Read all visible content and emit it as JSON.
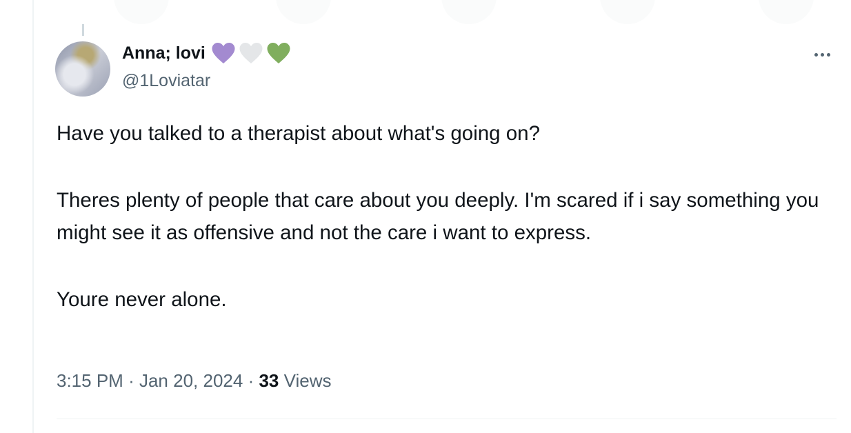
{
  "tweet": {
    "author_name": "Anna; lovi",
    "handle": "@1Loviatar",
    "emoji_hearts": [
      {
        "name": "purple-heart-icon",
        "color": "#a38ad0"
      },
      {
        "name": "white-heart-icon",
        "color": "#e4e6e8"
      },
      {
        "name": "green-heart-icon",
        "color": "#80ae5e"
      }
    ],
    "paragraphs": [
      "Have you talked to a therapist about what's going on?",
      "Theres plenty of people that care about you deeply. I'm scared if i say something you might see it as offensive and not the care i want to express.",
      "Youre never alone."
    ],
    "time": "3:15 PM",
    "date": "Jan 20, 2024",
    "separator": "·",
    "views_count": "33",
    "views_label": "Views"
  }
}
